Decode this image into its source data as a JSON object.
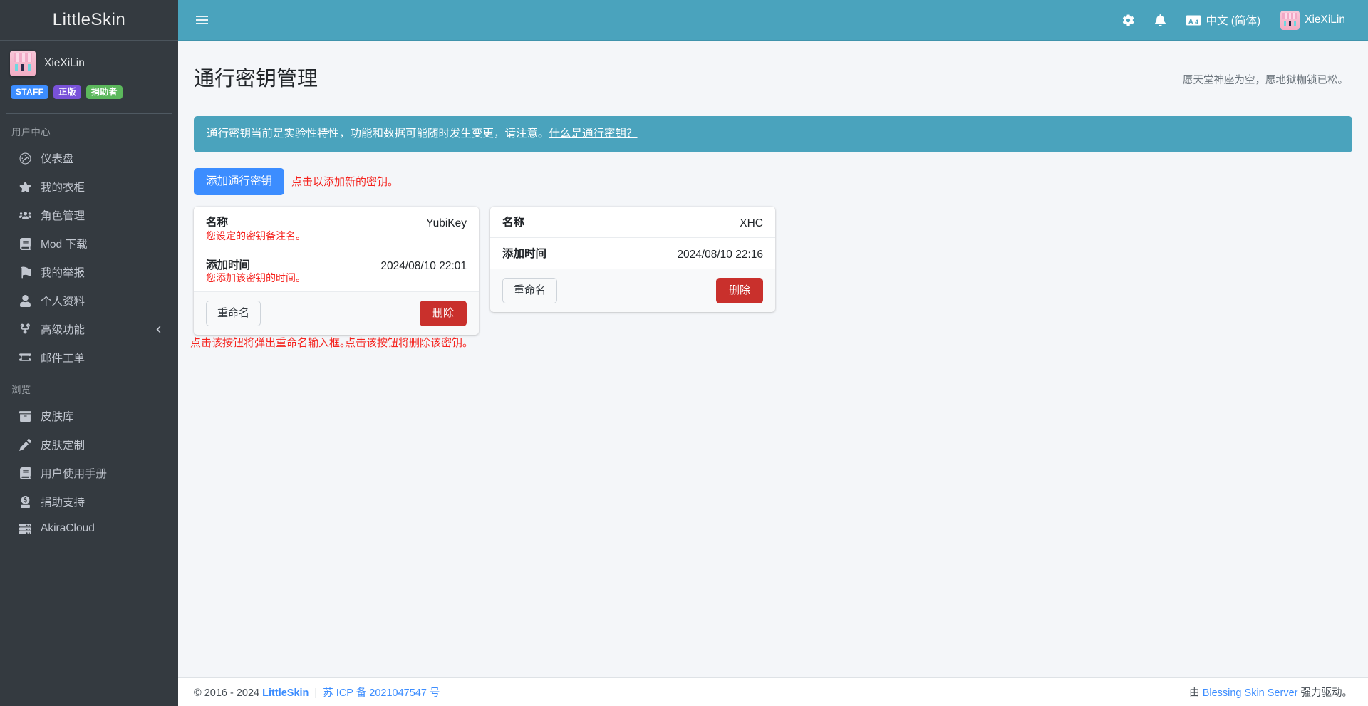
{
  "brand": {
    "name": "LittleSkin"
  },
  "user": {
    "name": "XieXiLin",
    "badges": [
      {
        "label": "STAFF",
        "color": "#3c8dff"
      },
      {
        "label": "正版",
        "color": "#7952d9"
      },
      {
        "label": "捐助者",
        "color": "#5cb85c"
      }
    ]
  },
  "sidebar": {
    "sections": [
      {
        "header": "用户中心",
        "items": [
          {
            "label": "仪表盘",
            "icon": "dashboard-icon"
          },
          {
            "label": "我的衣柜",
            "icon": "star-icon"
          },
          {
            "label": "角色管理",
            "icon": "users-icon"
          },
          {
            "label": "Mod 下载",
            "icon": "book-icon"
          },
          {
            "label": "我的举报",
            "icon": "flag-icon"
          },
          {
            "label": "个人资料",
            "icon": "user-icon"
          },
          {
            "label": "高级功能",
            "icon": "sitemap-icon",
            "arrow": "chevron-left-icon"
          },
          {
            "label": "邮件工单",
            "icon": "ticket-icon"
          }
        ]
      },
      {
        "header": "浏览",
        "items": [
          {
            "label": "皮肤库",
            "icon": "archive-icon"
          },
          {
            "label": "皮肤定制",
            "icon": "pencil-icon"
          },
          {
            "label": "用户使用手册",
            "icon": "book-icon"
          },
          {
            "label": "捐助支持",
            "icon": "donate-icon"
          },
          {
            "label": "AkiraCloud",
            "icon": "server-icon"
          }
        ]
      }
    ]
  },
  "topbar": {
    "menu_toggle": "hamburger-icon",
    "settings": "gear-icon",
    "notifications": "bell-icon",
    "language": "中文 (简体)",
    "language_icon": "language-icon",
    "username": "XieXiLin"
  },
  "page": {
    "title": "通行密钥管理",
    "tagline": "愿天堂神座为空，愿地狱枷锁已松。",
    "alert": {
      "text": "通行密钥当前是实验性特性，功能和数据可能随时发生变更，请注意。",
      "link": "什么是通行密钥？"
    },
    "add_button": "添加通行密钥",
    "add_button_annotation": "点击以添加新的密钥。"
  },
  "cards": [
    {
      "name_key": "名称",
      "name_sub": "您设定的密钥备注名。",
      "name_value": "YubiKey",
      "time_key": "添加时间",
      "time_sub": "您添加该密钥的时间。",
      "time_value": "2024/08/10 22:01",
      "rename_button": "重命名",
      "delete_button": "删除",
      "rename_annotation": "点击该按钮将弹出重命名输入框。",
      "delete_annotation": "点击该按钮将删除该密钥。"
    },
    {
      "name_key": "名称",
      "name_sub": "",
      "name_value": "XHC",
      "time_key": "添加时间",
      "time_sub": "",
      "time_value": "2024/08/10 22:16",
      "rename_button": "重命名",
      "delete_button": "删除",
      "rename_annotation": "",
      "delete_annotation": ""
    }
  ],
  "footer": {
    "copyright": "© 2016 - 2024",
    "brand": "LittleSkin",
    "icp": "苏 ICP 备 2021047547 号",
    "powered_prefix": "由",
    "powered_brand": "Blessing Skin Server",
    "powered_suffix": "强力驱动。"
  },
  "colors": {
    "sidebar_bg": "#343a40",
    "topbar_bg": "#4aa3bd",
    "primary": "#3c8dff",
    "danger": "#c9302c",
    "annotation": "#f5231e"
  }
}
